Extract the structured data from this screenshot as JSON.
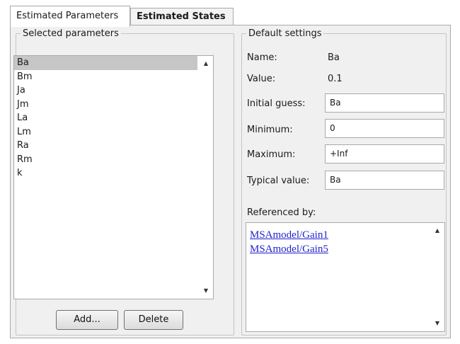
{
  "tabs": [
    {
      "label": "Estimated Parameters",
      "active": true
    },
    {
      "label": "Estimated States",
      "active": false
    }
  ],
  "selected_parameters": {
    "title": "Selected parameters",
    "items": [
      "Ba",
      "Bm",
      "Ja",
      "Jm",
      "La",
      "Lm",
      "Ra",
      "Rm",
      "k"
    ],
    "selected": "Ba",
    "add_label": "Add...",
    "delete_label": "Delete"
  },
  "default_settings": {
    "title": "Default settings",
    "name_label": "Name:",
    "name_value": "Ba",
    "value_label": "Value:",
    "value_value": "0.1",
    "initial_guess_label": "Initial guess:",
    "initial_guess_value": "Ba",
    "minimum_label": "Minimum:",
    "minimum_value": "0",
    "maximum_label": "Maximum:",
    "maximum_value": "+Inf",
    "typical_value_label": "Typical value:",
    "typical_value_value": "Ba",
    "referenced_by_label": "Referenced by:",
    "references": [
      "MSAmodel/Gain1",
      "MSAmodel/Gain5"
    ]
  },
  "icons": {
    "scroll_up": "scroll-up-arrow-icon",
    "scroll_down": "scroll-down-arrow-icon"
  },
  "colors": {
    "selection": "#c6c6c6",
    "link": "#1f1fcc",
    "panel_bg": "#f0f0f0"
  }
}
